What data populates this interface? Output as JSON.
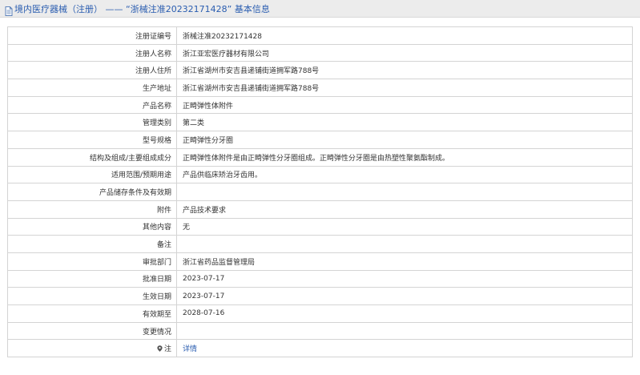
{
  "header": {
    "icon": "document-icon",
    "title": "境内医疗器械（注册） —— “浙械注准20232171428” 基本信息"
  },
  "rows": [
    {
      "label": "注册证编号",
      "value": "浙械注准20232171428"
    },
    {
      "label": "注册人名称",
      "value": "浙江亚宏医疗器材有限公司"
    },
    {
      "label": "注册人住所",
      "value": "浙江省湖州市安吉县递铺街道拥军路788号"
    },
    {
      "label": "生产地址",
      "value": "浙江省湖州市安吉县递铺街道拥军路788号"
    },
    {
      "label": "产品名称",
      "value": "正畸弹性体附件"
    },
    {
      "label": "管理类别",
      "value": "第二类"
    },
    {
      "label": "型号规格",
      "value": "正畸弹性分牙圈"
    },
    {
      "label": "结构及组成/主要组成成分",
      "value": "正畸弹性体附件是由正畸弹性分牙圈组成。正畸弹性分牙圈是由热塑性聚氨酯制成。"
    },
    {
      "label": "适用范围/预期用途",
      "value": "产品供临床矫治牙齿用。"
    },
    {
      "label": "产品储存条件及有效期",
      "value": ""
    },
    {
      "label": "附件",
      "value": "产品技术要求"
    },
    {
      "label": "其他内容",
      "value": "无"
    },
    {
      "label": "备注",
      "value": ""
    },
    {
      "label": "审批部门",
      "value": "浙江省药品监督管理局"
    },
    {
      "label": "批准日期",
      "value": "2023-07-17"
    },
    {
      "label": "生效日期",
      "value": "2023-07-17"
    },
    {
      "label": "有效期至",
      "value": "2028-07-16"
    },
    {
      "label": "变更情况",
      "value": ""
    }
  ],
  "note_row": {
    "icon": "location-pin-icon",
    "label": "注",
    "link_text": "详情"
  },
  "colors": {
    "header_bg": "#ececec",
    "title_color": "#2a5db0",
    "link_color": "#2a5db0",
    "border": "#d4d4d4"
  }
}
